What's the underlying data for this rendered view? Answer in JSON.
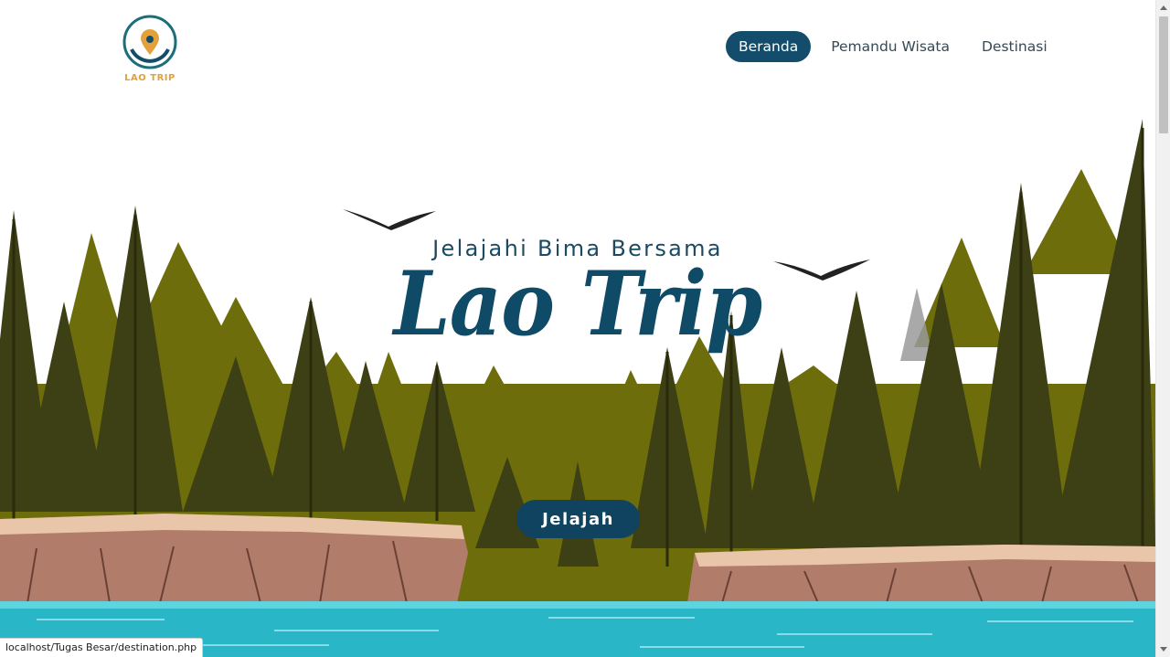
{
  "brand": {
    "logo_text": "LAO TRIP",
    "accent": "#134d6b",
    "gold": "#e3a13c"
  },
  "nav": {
    "items": [
      {
        "label": "Beranda",
        "active": true
      },
      {
        "label": "Pemandu Wisata",
        "active": false
      },
      {
        "label": "Destinasi",
        "active": false
      }
    ]
  },
  "hero": {
    "subtitle": "Jelajahi Bima Bersama",
    "title": "Lao Trip",
    "cta_label": "Jelajah"
  },
  "status_bar": {
    "url": "localhost/Tugas Besar/destination.php"
  },
  "colors": {
    "forest_light": "#6e6d0c",
    "forest_dark": "#3d3f14",
    "cliff": "#b17d6a",
    "water": "#29b6c7"
  }
}
